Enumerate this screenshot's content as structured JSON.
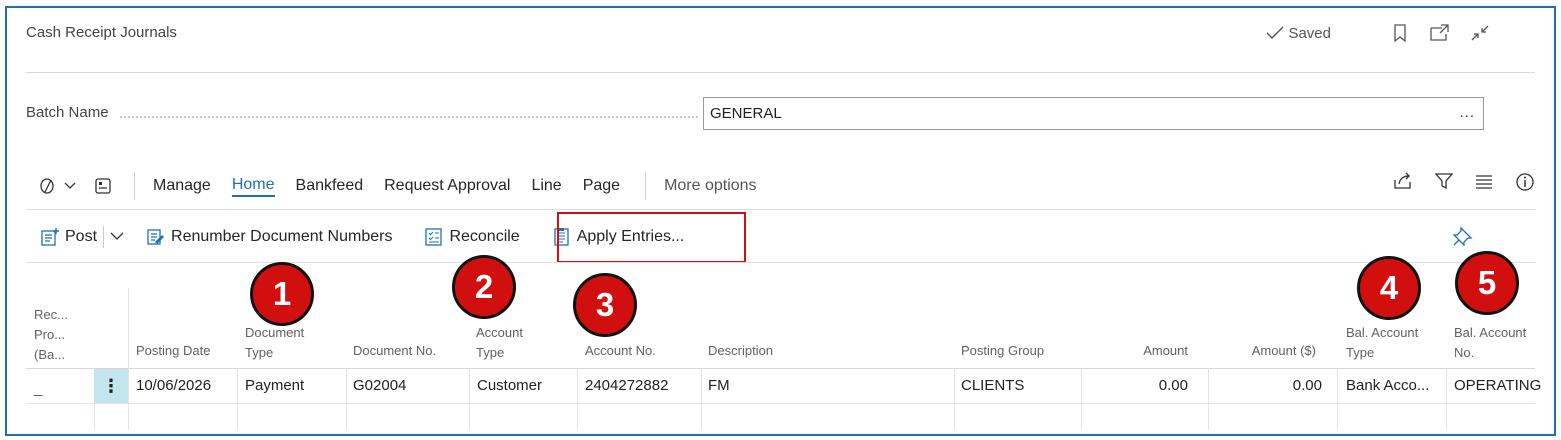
{
  "page": {
    "title": "Cash Receipt Journals",
    "status": "Saved"
  },
  "batch": {
    "label": "Batch Name",
    "value": "GENERAL",
    "more": "..."
  },
  "actionbar": {
    "items": [
      "Manage",
      "Home",
      "Bankfeed",
      "Request Approval",
      "Line",
      "Page"
    ],
    "active": "Home",
    "more": "More options"
  },
  "toolbar": {
    "post": "Post",
    "renumber": "Renumber Document Numbers",
    "reconcile": "Reconcile",
    "apply": "Apply Entries..."
  },
  "annotations": [
    "1",
    "2",
    "3",
    "4",
    "5"
  ],
  "table": {
    "headers": {
      "rec": [
        "Rec...",
        "Pro...",
        "(Ba..."
      ],
      "posting_date": "Posting Date",
      "document_type": [
        "Document",
        "Type"
      ],
      "document_no": "Document No.",
      "account_type": [
        "Account",
        "Type"
      ],
      "account_no": "Account No.",
      "description": "Description",
      "posting_group": "Posting Group",
      "amount": "Amount",
      "amount_usd": "Amount ($)",
      "bal_account_type": [
        "Bal. Account",
        "Type"
      ],
      "bal_account_no": [
        "Bal. Account",
        "No."
      ]
    },
    "rows": [
      {
        "rec": "_",
        "posting_date": "10/06/2026",
        "document_type": "Payment",
        "document_no": "G02004",
        "account_type": "Customer",
        "account_no": "2404272882",
        "description": "FM",
        "posting_group": "CLIENTS",
        "amount": "0.00",
        "amount_usd": "0.00",
        "bal_account_type": "Bank Acco...",
        "bal_account_no": "OPERATING"
      }
    ]
  },
  "colors": {
    "accent": "#1f6fb7",
    "highlight": "#d10f0f",
    "row_handle": "#c3e6ee"
  }
}
